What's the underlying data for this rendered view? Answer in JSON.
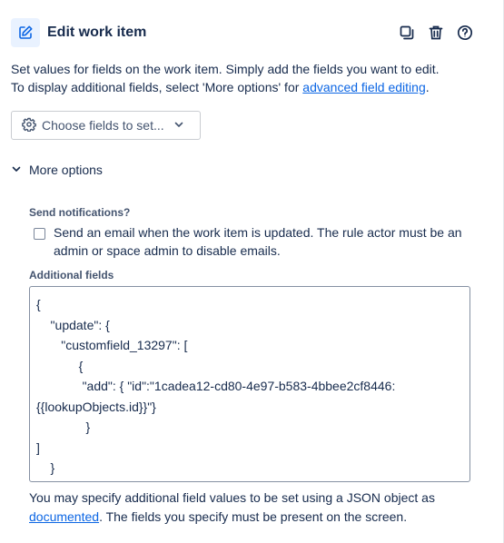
{
  "header": {
    "title": "Edit work item",
    "icons": [
      "edit-icon",
      "duplicate-icon",
      "trash-icon",
      "help-icon"
    ],
    "accent_color": "#0c66e4",
    "icon_bg": "#e9f2ff"
  },
  "description": {
    "line1": "Set values for fields on the work item. Simply add the fields you want to edit.",
    "line2_prefix": "To display additional fields, select 'More options' for ",
    "line2_link": "advanced field editing",
    "line2_suffix": "."
  },
  "choose_fields": {
    "label": "Choose fields to set..."
  },
  "more_options": {
    "label": "More options",
    "expanded": true
  },
  "send_notifications": {
    "label": "Send notifications?",
    "checkbox_text": "Send an email when the work item is updated. The rule actor must be an admin or space admin to disable emails.",
    "checked": false
  },
  "additional_fields": {
    "label": "Additional fields",
    "value": "{\n    \"update\": {\n       \"customfield_13297\": [\n            {\n             \"add\": { \"id\":\"1cadea12-cd80-4e97-b583-4bbee2cf8446:\n{{lookupObjects.id}}\"}\n              }\n]\n    }\n}"
  },
  "footer": {
    "prefix": "You may specify additional field values to be set using a JSON object as ",
    "link": "documented",
    "suffix": ". The fields you specify must be present on the screen."
  }
}
